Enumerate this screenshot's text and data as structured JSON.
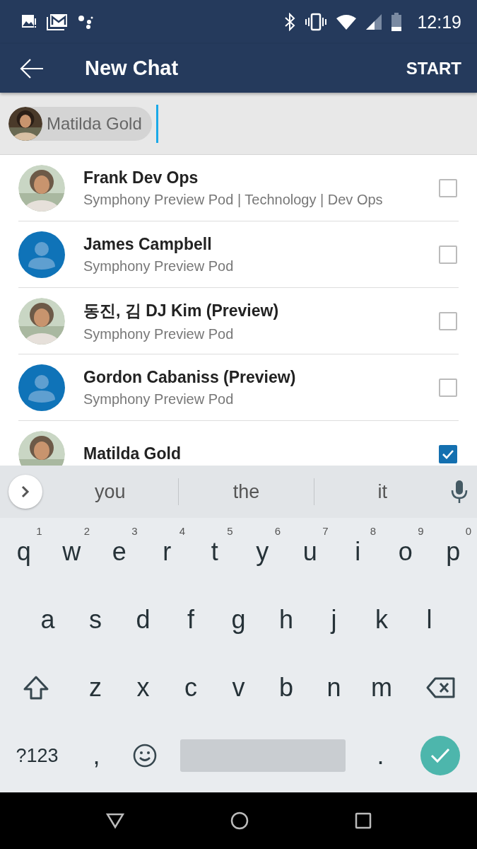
{
  "status_bar": {
    "time": "12:19"
  },
  "app_bar": {
    "title": "New Chat",
    "action": "START"
  },
  "recipients": [
    {
      "name": "Matilda Gold"
    }
  ],
  "contacts": [
    {
      "name": "Frank Dev Ops",
      "subtitle": "Symphony Preview Pod | Technology | Dev Ops",
      "photo": true,
      "checked": false
    },
    {
      "name": "James Campbell",
      "subtitle": "Symphony Preview Pod",
      "photo": false,
      "checked": false
    },
    {
      "name": "동진, 김 DJ Kim (Preview)",
      "subtitle": "Symphony Preview Pod",
      "photo": true,
      "checked": false
    },
    {
      "name": "Gordon Cabaniss (Preview)",
      "subtitle": "Symphony Preview Pod",
      "photo": false,
      "checked": false
    },
    {
      "name": "Matilda Gold",
      "photo": true,
      "checked": true
    }
  ],
  "keyboard": {
    "suggestions": [
      "you",
      "the",
      "it"
    ],
    "rows": [
      [
        {
          "kind": "letter",
          "label": "q",
          "hint": "1"
        },
        {
          "kind": "letter",
          "label": "w",
          "hint": "2"
        },
        {
          "kind": "letter",
          "label": "e",
          "hint": "3"
        },
        {
          "kind": "letter",
          "label": "r",
          "hint": "4"
        },
        {
          "kind": "letter",
          "label": "t",
          "hint": "5"
        },
        {
          "kind": "letter",
          "label": "y",
          "hint": "6"
        },
        {
          "kind": "letter",
          "label": "u",
          "hint": "7"
        },
        {
          "kind": "letter",
          "label": "i",
          "hint": "8"
        },
        {
          "kind": "letter",
          "label": "o",
          "hint": "9"
        },
        {
          "kind": "letter",
          "label": "p",
          "hint": "0"
        }
      ],
      [
        {
          "kind": "letter",
          "label": "a"
        },
        {
          "kind": "letter",
          "label": "s"
        },
        {
          "kind": "letter",
          "label": "d"
        },
        {
          "kind": "letter",
          "label": "f"
        },
        {
          "kind": "letter",
          "label": "g"
        },
        {
          "kind": "letter",
          "label": "h"
        },
        {
          "kind": "letter",
          "label": "j"
        },
        {
          "kind": "letter",
          "label": "k"
        },
        {
          "kind": "letter",
          "label": "l"
        }
      ],
      [
        {
          "kind": "shift"
        },
        {
          "kind": "letter",
          "label": "z"
        },
        {
          "kind": "letter",
          "label": "x"
        },
        {
          "kind": "letter",
          "label": "c"
        },
        {
          "kind": "letter",
          "label": "v"
        },
        {
          "kind": "letter",
          "label": "b"
        },
        {
          "kind": "letter",
          "label": "n"
        },
        {
          "kind": "letter",
          "label": "m"
        },
        {
          "kind": "backspace"
        }
      ]
    ],
    "bottom_row": {
      "symbols": "?123",
      "comma": ",",
      "period": "."
    }
  }
}
